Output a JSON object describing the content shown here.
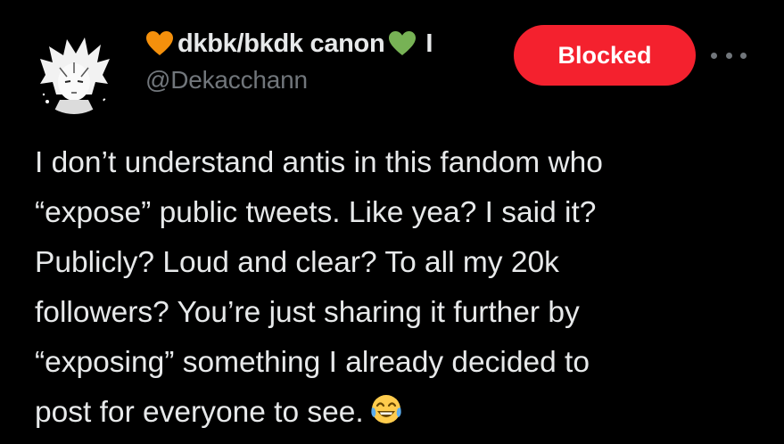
{
  "tweet": {
    "display_name": "dkbk/bkdk canon",
    "name_suffix": "I",
    "handle": "@Dekacchann",
    "blocked_label": "Blocked",
    "body_lines": [
      "I don’t understand antis in this fandom who",
      "“expose” public tweets. Like yea? I said it?",
      "Publicly? Loud and clear? To all my 20k",
      "followers? You’re just sharing it further by",
      "“exposing” something I already decided to",
      "post for everyone to see."
    ],
    "icons": {
      "name_prefix": "orange-heart-icon",
      "name_suffix": "green-heart-icon",
      "body_end": "tears-of-joy-emoji-icon",
      "menu": "more-options-icon"
    },
    "colors": {
      "background": "#000000",
      "text": "#e7e9ea",
      "secondary_text": "#71767b",
      "blocked_button": "#f4212e",
      "orange_heart": "#f4900c",
      "green_heart": "#77b255"
    }
  }
}
